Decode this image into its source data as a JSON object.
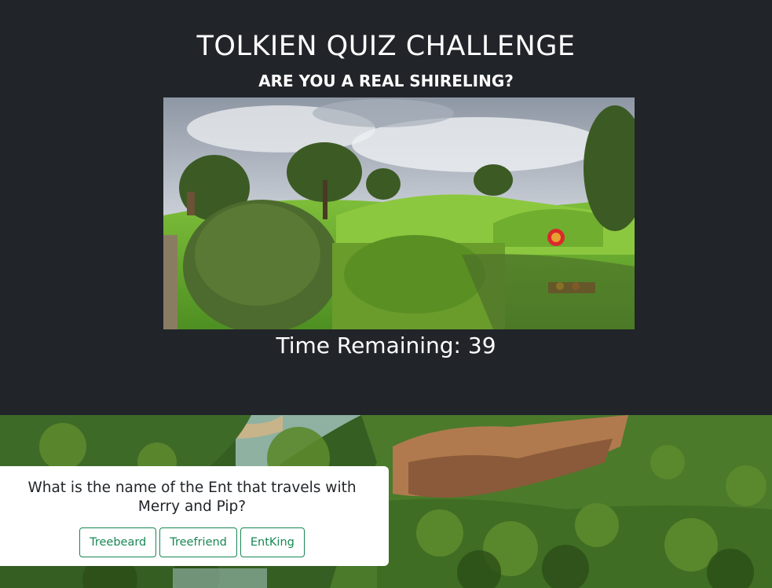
{
  "header": {
    "title": "TOLKIEN QUIZ CHALLENGE",
    "subtitle": "ARE YOU A REAL SHIRELING?",
    "timer_label": "Time Remaining:",
    "timer_value": "39"
  },
  "quiz": {
    "question": "What is the name of the Ent that travels with Merry and Pip?",
    "answers": [
      "Treebeard",
      "Treefriend",
      "EntKing"
    ]
  },
  "colors": {
    "background": "#212529",
    "accent": "#198754"
  }
}
